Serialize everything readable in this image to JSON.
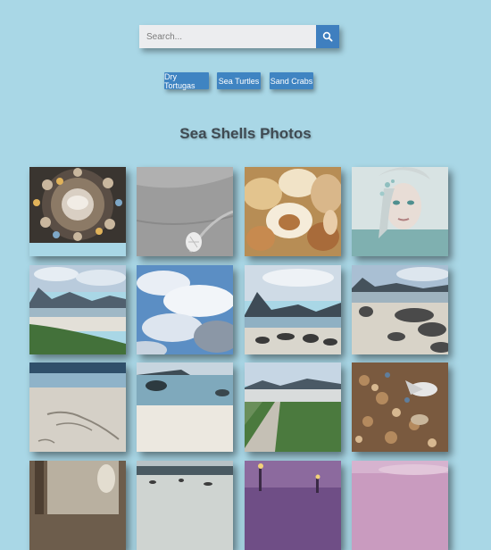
{
  "search": {
    "placeholder": "Search...",
    "value": "",
    "icon": "search-icon"
  },
  "tags": [
    "Dry Tortugas",
    "Sea Turtles",
    "Sand Crabs"
  ],
  "page_title": "Sea Shells Photos",
  "photos": [
    {
      "subject": "shell mosaic"
    },
    {
      "subject": "shell on sand"
    },
    {
      "subject": "pile of conch shells"
    },
    {
      "subject": "mermaid portrait"
    },
    {
      "subject": "beach with green shore"
    },
    {
      "subject": "cloudy sky"
    },
    {
      "subject": "rocky beach and mountains"
    },
    {
      "subject": "beach rocks"
    },
    {
      "subject": "writing in sand"
    },
    {
      "subject": "beach and sea rocks"
    },
    {
      "subject": "boardwalk path through grass"
    },
    {
      "subject": "shells with seagull"
    },
    {
      "subject": "window with vases"
    },
    {
      "subject": "shoreline"
    },
    {
      "subject": "evening pier lights"
    },
    {
      "subject": "pink sunset"
    }
  ]
}
